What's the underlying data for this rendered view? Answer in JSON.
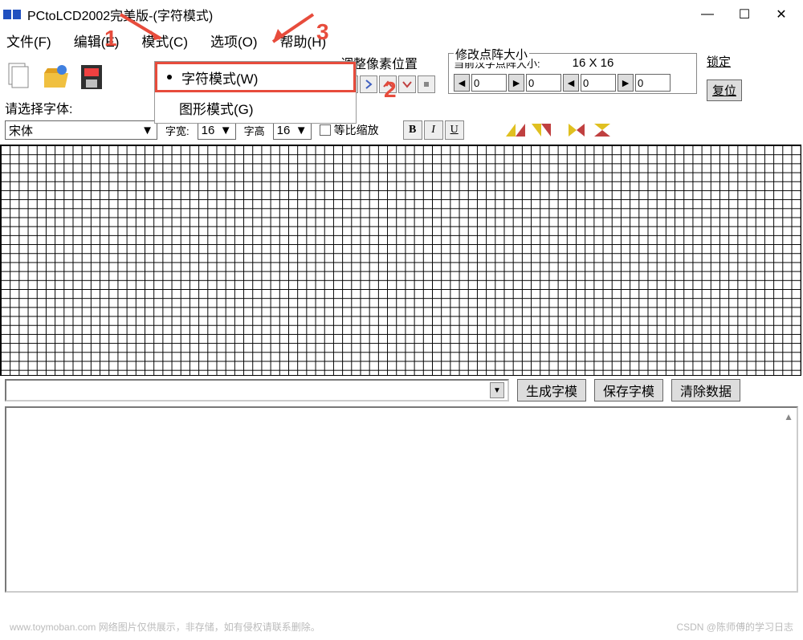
{
  "window": {
    "title": "PCtoLCD2002完美版-(字符模式)",
    "min": "—",
    "max": "☐",
    "close": "✕"
  },
  "menu": {
    "file": "文件(F)",
    "edit": "编辑(E)",
    "mode": "模式(C)",
    "options": "选项(O)",
    "help": "帮助(H)"
  },
  "dropdown": {
    "char_mode": "字符模式(W)",
    "graphic_mode": "图形模式(G)"
  },
  "pixel_adjust": {
    "label": "调整像素位置"
  },
  "matrix": {
    "group_label": "修改点阵大小",
    "sub_label": "当前汉字点阵大小:",
    "size": "16 X 16",
    "val1": "0",
    "val2": "0",
    "val3": "0",
    "val4": "0"
  },
  "lock": {
    "label": "锁定",
    "reset": "复位"
  },
  "font": {
    "select_label": "请选择字体:",
    "selected": "宋体",
    "width_label": "字宽:",
    "width_val": "16",
    "height_label": "字高",
    "height_val": "16",
    "ratio_label": "等比缩放"
  },
  "style": {
    "bold": "B",
    "italic": "I",
    "underline": "U"
  },
  "actions": {
    "generate": "生成字模",
    "save": "保存字模",
    "clear": "清除数据"
  },
  "annotations": {
    "n1": "1",
    "n2": "2",
    "n3": "3"
  },
  "watermark": {
    "right": "CSDN @陈师傅的学习日志",
    "left": "www.toymoban.com 网络图片仅供展示，非存储，如有侵权请联系删除。"
  }
}
